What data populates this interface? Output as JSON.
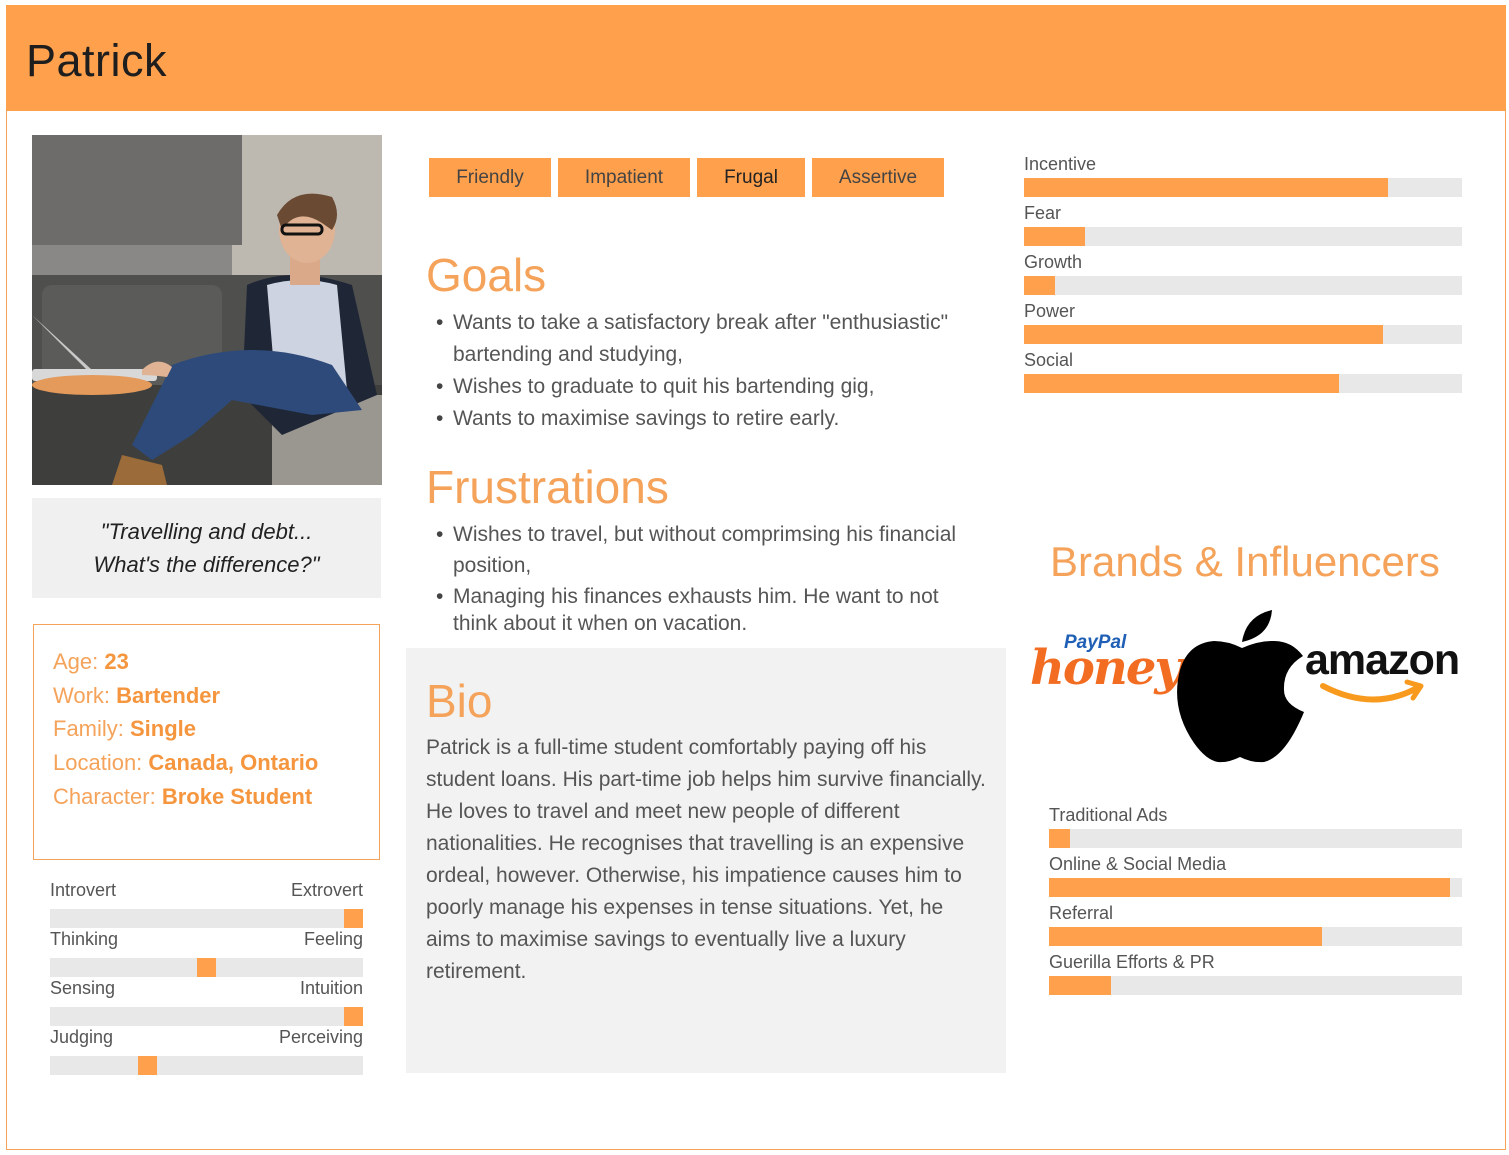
{
  "persona": {
    "name": "Patrick"
  },
  "quote": {
    "line1": "\"Travelling and debt...",
    "line2": "What's the difference?\""
  },
  "profile": [
    {
      "label": "Age: ",
      "value": "23"
    },
    {
      "label": "Work: ",
      "value": "Bartender"
    },
    {
      "label": "Family: ",
      "value": "Single"
    },
    {
      "label": "Location: ",
      "value": "Canada, Ontario"
    },
    {
      "label": "Character: ",
      "value": "Broke Student"
    }
  ],
  "personality": [
    {
      "left": "Introvert",
      "right": "Extrovert",
      "position": 1.0
    },
    {
      "left": "Thinking",
      "right": "Feeling",
      "position": 0.5
    },
    {
      "left": "Sensing",
      "right": "Intuition",
      "position": 1.0
    },
    {
      "left": "Judging",
      "right": "Perceiving",
      "position": 0.3
    }
  ],
  "tags": [
    "Friendly",
    "Impatient",
    "Frugal",
    "Assertive"
  ],
  "goals": {
    "title": "Goals",
    "items": [
      "Wants to take a satisfactory break after \"enthusiastic\" bartending and studying,",
      "Wishes to graduate to quit his bartending gig,",
      "Wants to maximise savings to retire early."
    ]
  },
  "frustrations": {
    "title": "Frustrations",
    "items": [
      "Wishes to travel, but without comprimsing his financial position,",
      "Managing his finances exhausts him. He want to not think about it when on vacation."
    ]
  },
  "bio": {
    "title": "Bio",
    "text": "Patrick is a full-time student comfortably paying off his student loans. His part-time job helps him survive financially. He loves to travel and meet new people of different nationalities. He recognises that travelling is an expensive ordeal, however. Otherwise, his impatience causes him to poorly manage his expenses in tense situations. Yet, he aims to maximise savings to eventually live a luxury retirement."
  },
  "motivations": [
    {
      "label": "Incentive",
      "value": 0.83
    },
    {
      "label": "Fear",
      "value": 0.14
    },
    {
      "label": "Growth",
      "value": 0.07
    },
    {
      "label": "Power",
      "value": 0.82
    },
    {
      "label": "Social",
      "value": 0.72
    }
  ],
  "brands": {
    "title": "Brands & Influencers",
    "logos": [
      {
        "name": "honey-logo",
        "text_top": "PayPal",
        "text_main": "honey",
        "color": "#f26c21"
      },
      {
        "name": "apple-logo"
      },
      {
        "name": "amazon-logo",
        "text_main": "amazon"
      }
    ]
  },
  "channels": [
    {
      "label": "Traditional Ads",
      "value": 0.05
    },
    {
      "label": "Online & Social Media",
      "value": 0.97
    },
    {
      "label": "Referral",
      "value": 0.66
    },
    {
      "label": "Guerilla Efforts & PR",
      "value": 0.15
    }
  ],
  "colors": {
    "accent": "#ffa04c",
    "accent_text": "#f5a35a",
    "track": "#e8e8e8",
    "panel": "#f2f2f2"
  }
}
